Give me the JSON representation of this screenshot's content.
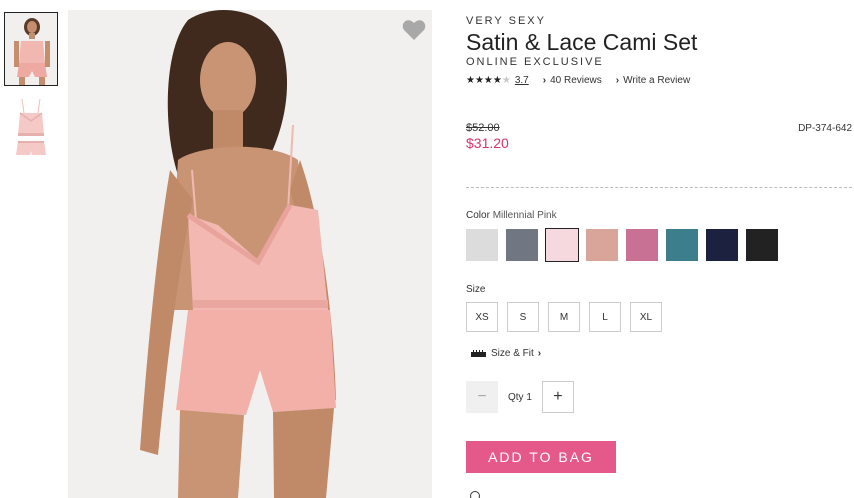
{
  "product": {
    "brand": "VERY SEXY",
    "title": "Satin & Lace Cami Set",
    "exclusive": "ONLINE EXCLUSIVE",
    "rating": 3.7,
    "rating_text": "3.7",
    "reviews_link": "40 Reviews",
    "write_review_link": "Write a Review",
    "original_price": "$52.00",
    "sale_price": "$31.20",
    "sku": "DP-374-642"
  },
  "color": {
    "label": "Color",
    "selected": "Millennial Pink",
    "swatches": [
      "#dcdcdc",
      "#707682",
      "#f6d9df",
      "#d9a59b",
      "#c97195",
      "#3d7e8c",
      "#1d2140",
      "#222222"
    ],
    "selected_index": 2
  },
  "size": {
    "label": "Size",
    "options": [
      "XS",
      "S",
      "M",
      "L",
      "XL"
    ]
  },
  "size_fit_link": "Size & Fit",
  "quantity": {
    "minus": "−",
    "label": "Qty 1",
    "plus": "+"
  },
  "add_to_bag": "ADD TO BAG",
  "colors": {
    "accent": "#e5588a",
    "sale": "#d6336c"
  }
}
